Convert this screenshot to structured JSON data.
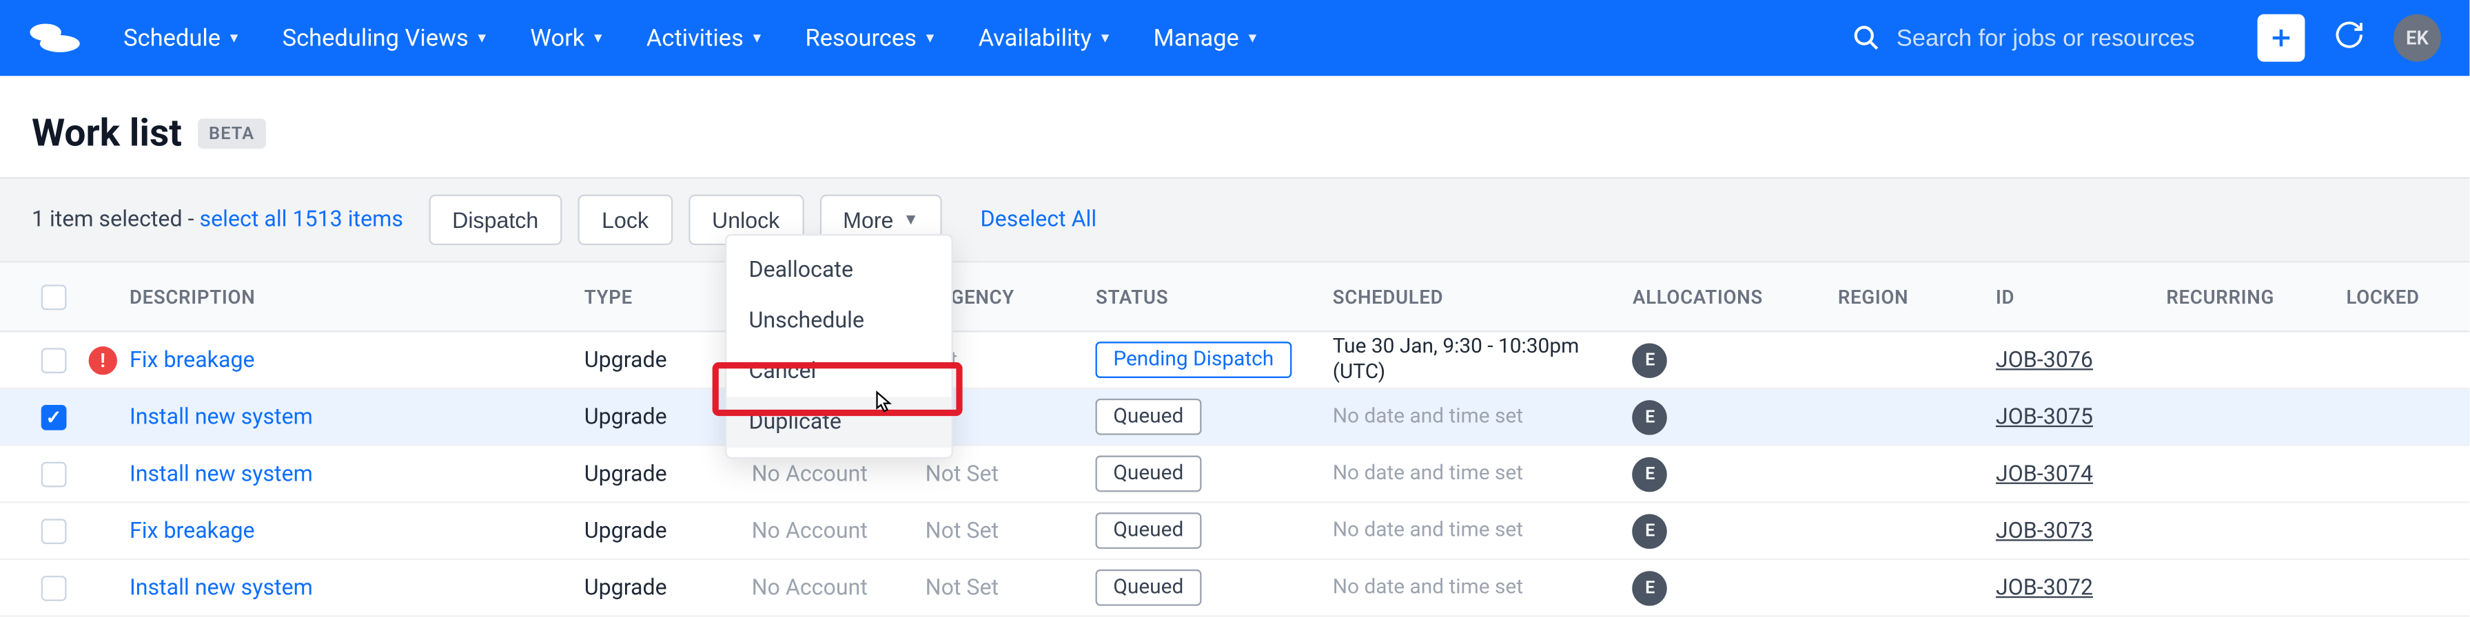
{
  "nav": {
    "items": [
      "Schedule",
      "Scheduling Views",
      "Work",
      "Activities",
      "Resources",
      "Availability",
      "Manage"
    ],
    "search_placeholder": "Search for jobs or resources",
    "avatar": "EK"
  },
  "page": {
    "title": "Work list",
    "badge": "BETA"
  },
  "toolbar": {
    "selected_text": "1 item selected - ",
    "select_all": "select all 1513 items",
    "buttons": {
      "dispatch": "Dispatch",
      "lock": "Lock",
      "unlock": "Unlock",
      "more": "More"
    },
    "deselect": "Deselect All"
  },
  "more_menu": {
    "items": [
      "Deallocate",
      "Unschedule",
      "Cancel",
      "Duplicate"
    ],
    "highlighted_index": 3
  },
  "columns": [
    "DESCRIPTION",
    "TYPE",
    "",
    "URGENCY",
    "STATUS",
    "SCHEDULED",
    "ALLOCATIONS",
    "REGION",
    "ID",
    "RECURRING",
    "LOCKED"
  ],
  "rows": [
    {
      "selected": false,
      "warn": true,
      "desc": "Fix breakage",
      "type": "Upgrade",
      "acct": "",
      "urg": "Set",
      "status": "Pending Dispatch",
      "status_kind": "pending",
      "sched": "Tue 30 Jan, 9:30 - 10:30pm (UTC)",
      "alloc": "E",
      "id": "JOB-3076"
    },
    {
      "selected": true,
      "warn": false,
      "desc": "Install new system",
      "type": "Upgrade",
      "acct": "",
      "urg": "t",
      "status": "Queued",
      "status_kind": "queued",
      "sched": "No date and time set",
      "alloc": "E",
      "id": "JOB-3075"
    },
    {
      "selected": false,
      "warn": false,
      "desc": "Install new system",
      "type": "Upgrade",
      "acct": "No Account",
      "urg": "Not Set",
      "status": "Queued",
      "status_kind": "queued",
      "sched": "No date and time set",
      "alloc": "E",
      "id": "JOB-3074"
    },
    {
      "selected": false,
      "warn": false,
      "desc": "Fix breakage",
      "type": "Upgrade",
      "acct": "No Account",
      "urg": "Not Set",
      "status": "Queued",
      "status_kind": "queued",
      "sched": "No date and time set",
      "alloc": "E",
      "id": "JOB-3073"
    },
    {
      "selected": false,
      "warn": false,
      "desc": "Install new system",
      "type": "Upgrade",
      "acct": "No Account",
      "urg": "Not Set",
      "status": "Queued",
      "status_kind": "queued",
      "sched": "No date and time set",
      "alloc": "E",
      "id": "JOB-3072"
    }
  ],
  "colors": {
    "primary": "#0d6efd",
    "danger": "#ef4444",
    "highlight": "#e11d2c"
  }
}
